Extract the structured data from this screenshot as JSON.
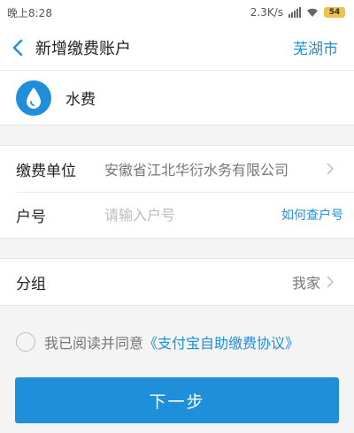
{
  "status_bar": {
    "time": "晚上8:28",
    "network_speed": "2.3K/s",
    "battery": "54",
    "signal_icon": "signal-icon",
    "wifi_icon": "wifi-icon"
  },
  "header": {
    "title": "新增缴费账户",
    "city": "芜湖市",
    "back_icon": "back-arrow-icon"
  },
  "bill_type": {
    "icon": "water-drop-icon",
    "label": "水费"
  },
  "form": {
    "payee_label": "缴费单位",
    "payee_value": "安徽省江北华衍水务有限公司",
    "account_label": "户号",
    "account_placeholder": "请输入户号",
    "account_help": "如何查户号",
    "group_label": "分组",
    "group_value": "我家"
  },
  "agreement": {
    "text": "我已阅读并同意",
    "link": "《支付宝自助缴费协议》",
    "checked": false
  },
  "actions": {
    "next_label": "下一步"
  },
  "colors": {
    "accent": "#1e8fd8",
    "background": "#f4f4f4"
  }
}
